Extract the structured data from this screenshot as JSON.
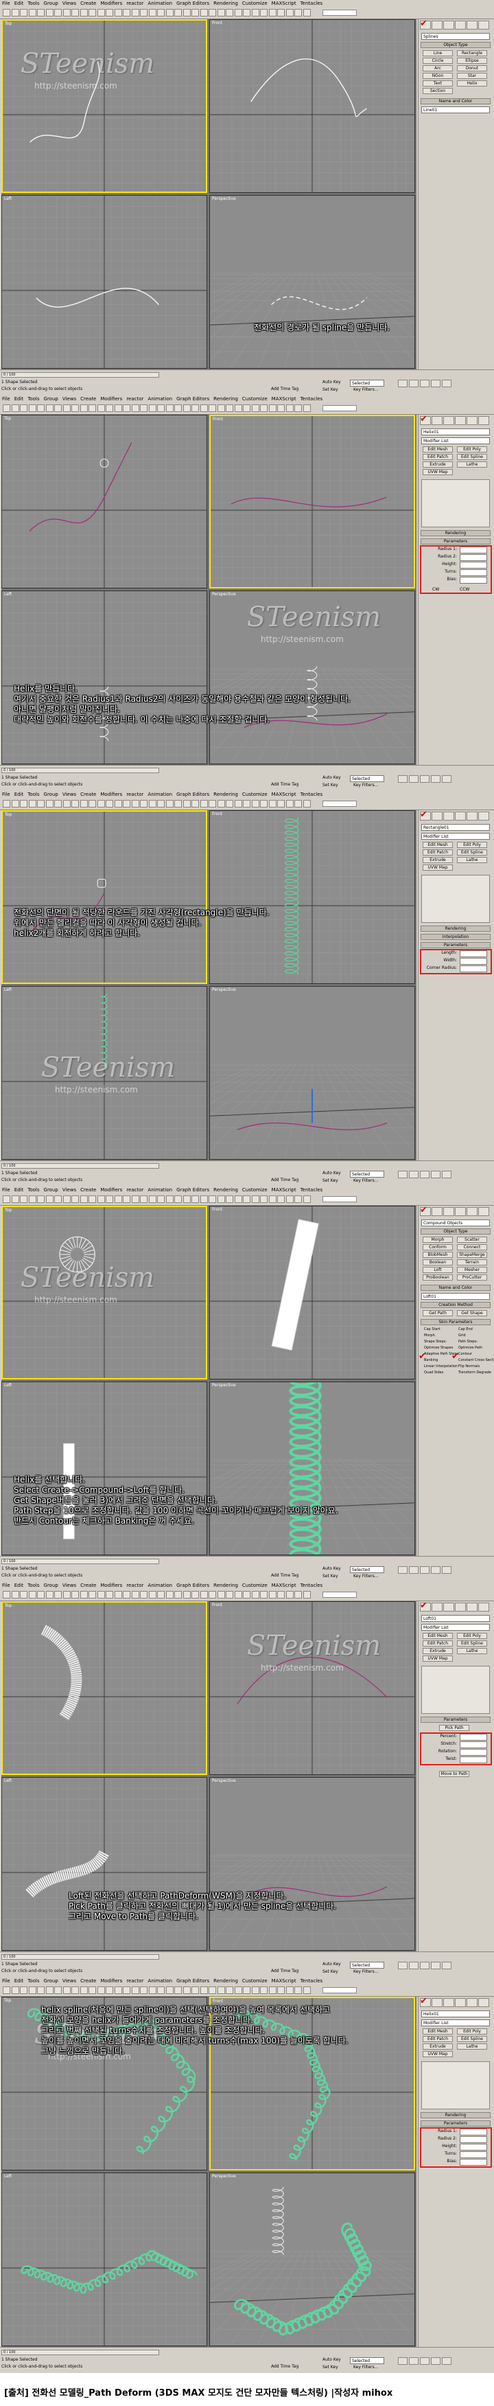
{
  "menu": [
    "File",
    "Edit",
    "Tools",
    "Group",
    "Views",
    "Create",
    "Modifiers",
    "reactor",
    "Animation",
    "Graph Editors",
    "Rendering",
    "Customize",
    "MAXScript",
    "Tentacles"
  ],
  "viewport_labels": [
    "Top",
    "Front",
    "Left",
    "Perspective"
  ],
  "status": {
    "selection": "1 Shape Selected",
    "prompt": "Click or click-and-drag to select objects",
    "frame_counter": "0 / 100",
    "auto_key": "Auto Key",
    "selected_dropdown": "Selected",
    "set_key": "Set Key",
    "key_filters": "Key Filters...",
    "add_time_tag": "Add Time Tag"
  },
  "watermark": {
    "text": "STeenism",
    "url": "http://steenism.com"
  },
  "panels": [
    {
      "caption": "전화선의 경로가 될 spline을 만듭니다.",
      "cmd": {
        "field": "Splines",
        "rollout1": "Object Type",
        "buttons": [
          "Line",
          "Rectangle",
          "Circle",
          "Ellipse",
          "Arc",
          "Donut",
          "NGon",
          "Star",
          "Text",
          "Helix",
          "Section"
        ],
        "rollout2": "Name and Color",
        "name": "Line01"
      }
    },
    {
      "caption": "Helix를 만듭니다.\n여기서 중요한 것은 Radius1과 Radius2의 사이즈가 동일해야 용수철과 같은 모양이 형성됩니다.\n아니면 달팽이처럼 말아집니다.\n대략적인 높이와 회전수를 정합니다. 이 수치는 나중에 다시 조절할 겁니다.",
      "cmd": {
        "field": "Helix01",
        "modifier": "Modifier List",
        "buttons": [
          "Edit Mesh",
          "Edit Poly",
          "Edit Patch",
          "Edit Spline",
          "Extrude",
          "Lathe",
          "UVW Map"
        ],
        "rollout1": "Rendering",
        "rollout2": "Parameters",
        "params": [
          "Radius 1:",
          "Radius 2:",
          "Height:",
          "Turns:",
          "Bias:"
        ],
        "options": [
          "CW",
          "CCW"
        ]
      }
    },
    {
      "caption": "전화선의 단면이 될 적당한 라운드를 가진 사각형(rectangle)을 만듭니다.\n위에서 만든 헬리컬을 따라 이 사각형이 생성될 겁니다.\nhelix2개를 회전하게 하려고 합니다.",
      "cmd": {
        "field": "Rectangle01",
        "modifier": "Modifier List",
        "buttons": [
          "Edit Mesh",
          "Edit Poly",
          "Edit Patch",
          "Edit Spline",
          "Extrude",
          "Lathe",
          "UVW Map"
        ],
        "rollout1": "Rendering",
        "rollout2": "Interpolation",
        "rollout3": "Parameters",
        "params": [
          "Length:",
          "Width:",
          "Corner Radius:"
        ]
      }
    },
    {
      "caption": "Helix를 선택합니다.\nSelect Create->Compound->Loft를 합니다.\nGet Shape버튼을 눌러 3)에서 그려준 단면을 선택합니다.\nPath Step을 10으로 조정합니다. 값을 100 이하면 곡선이 꼬이거나 매끄럽게 보이지 않아요.\n반드시 Contour는 체크하고 Banking은 꺼 주세요.",
      "cmd": {
        "field": "Compound Objects",
        "rollout1": "Object Type",
        "buttons": [
          "Morph",
          "Scatter",
          "Conform",
          "Connect",
          "BlobMesh",
          "ShapeMerge",
          "Boolean",
          "Terrain",
          "Loft",
          "Mesher",
          "ProBoolean",
          "ProCutter"
        ],
        "rollout2": "Name and Color",
        "name": "Loft01",
        "rollout3": "Creation Method",
        "get_buttons": [
          "Get Path",
          "Get Shape"
        ],
        "rollout4": "Skin Parameters",
        "checks": [
          "Cap Start",
          "Cap End",
          "Morph",
          "Grid",
          "Shape Steps:",
          "Path Steps:",
          "Optimize Shapes",
          "Optimize Path",
          "Adaptive Path Steps",
          "Contour",
          "Banking",
          "Constant Cross-Section",
          "Linear Interpolation",
          "Flip Normals",
          "Quad Sides",
          "Transform Degrade"
        ]
      }
    },
    {
      "caption": "Loft된 전화선을 선택하고 PathDeform(WSM)을 지정합니다.\nPick Path를 클릭하고 전화선의 뼈대가 될 1)에서 만든 spline을 선택합니다.\n그리고 Move to Path를 클릭합니다.",
      "cmd": {
        "field": "Loft01",
        "modifier": "Modifier List",
        "buttons": [
          "Edit Mesh",
          "Edit Poly",
          "Edit Patch",
          "Edit Spline",
          "Extrude",
          "Lathe",
          "UVW Map"
        ],
        "rollout1": "Parameters",
        "pick_path": "Pick Path",
        "params": [
          "Percent:",
          "Stretch:",
          "Rotation:",
          "Twist:"
        ],
        "move_to_path": "Move to Path"
      }
    },
    {
      "caption": "helix spline(처음에 만든 spline이)을 선택(선택하여야)을 높여 목록에서 선택하고\n전화선 모양을 helix가 들어가게 parameters를 조정합니다.\n그리고 번째 선택된 turns수치를 조정합니다. 높이를 조정합니다.\n높이를 높이면서 꼬임을 줄이려는 대에 비례해서 turns수(max 100)를 늘이도록 합니다.\n그냥 느낌으로 만듭니다.",
      "cmd": {
        "field": "Helix01",
        "modifier": "Modifier List",
        "buttons": [
          "Edit Mesh",
          "Edit Poly",
          "Edit Patch",
          "Edit Spline",
          "Extrude",
          "Lathe",
          "UVW Map"
        ],
        "rollout1": "Rendering",
        "rollout2": "Parameters",
        "params": [
          "Radius 1:",
          "Radius 2:",
          "Height:",
          "Turns:",
          "Bias:"
        ]
      }
    }
  ],
  "footer": "[출처] 전화선 모델링_Path Deform (3DS MAX 모지도 건단 모자만들 텍스처링) |작성자 mihox"
}
